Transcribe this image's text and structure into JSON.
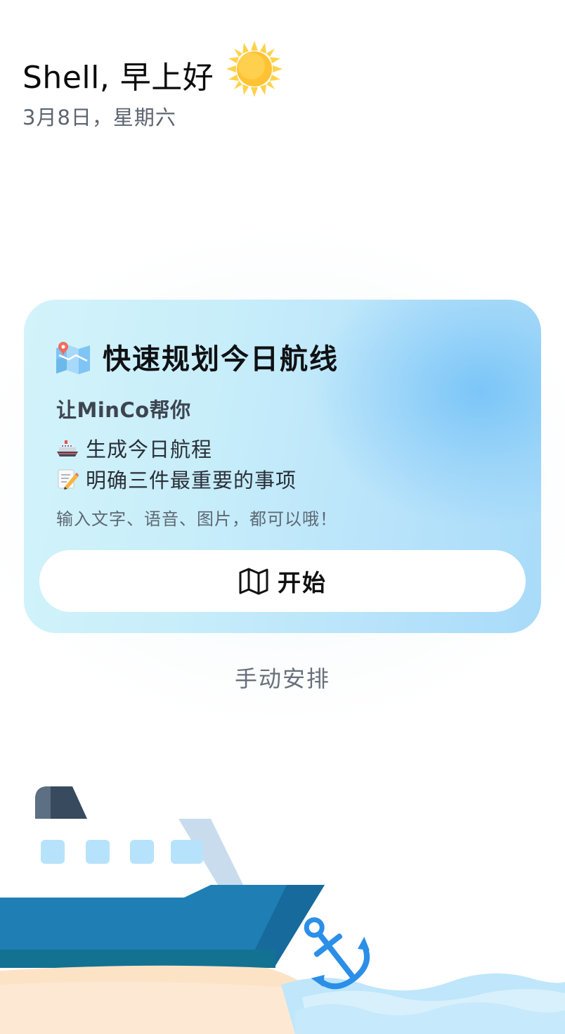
{
  "header": {
    "greeting": "Shell, 早上好",
    "date": "3月8日，星期六",
    "weather_icon": "sun-icon"
  },
  "card": {
    "title": "快速规划今日航线",
    "title_icon": "map-icon",
    "subtitle": "让MinCo帮你",
    "bullets": [
      {
        "icon": "cruise-ship-icon",
        "label": "生成今日航程"
      },
      {
        "icon": "memo-icon",
        "label": "明确三件最重要的事项"
      }
    ],
    "hint": "输入文字、语音、图片，都可以哦！",
    "start_button": {
      "icon": "map-outline-icon",
      "label": "开始"
    }
  },
  "manual_link": "手动安排",
  "colors": {
    "card_gradient_start": "#d3f3fa",
    "card_gradient_end": "#a8dbf9",
    "hull_blue": "#1f7fb4",
    "anchor_blue": "#2b8fe8",
    "sand": "#fde3c6",
    "water": "#bfe6fb"
  }
}
